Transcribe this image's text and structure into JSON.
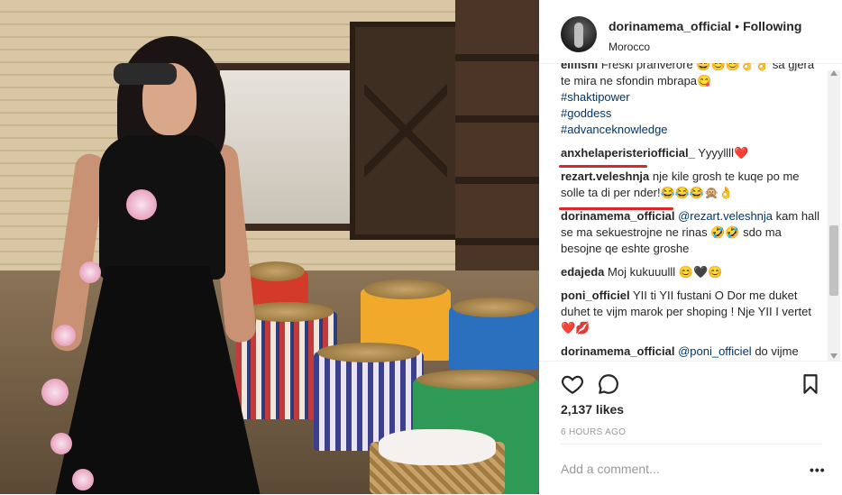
{
  "post": {
    "username": "dorinamema_official",
    "separator": "•",
    "follow_label": "Following",
    "location": "Morocco"
  },
  "comments": [
    {
      "user": "elifishi",
      "text": "Freski pranverore 😄😊😊👌👌",
      "extra": "sa gjera te mira ne sfondin mbrapa😋",
      "tags": [
        "#shaktipower",
        "#goddess",
        "#advanceknowledge"
      ]
    },
    {
      "user": "anxhelaperisteriofficial_",
      "text": "Yyyyllll❤️"
    },
    {
      "user": "rezart.veleshnja",
      "text": "nje kile grosh te kuqe po me solle ta di per nder!😂😂😂🙊👌"
    },
    {
      "user": "dorinamema_official",
      "mention": "@rezart.veleshnja",
      "text": "kam hall se ma sekuestrojne ne rinas 🤣🤣 sdo ma besojne qe eshte groshe"
    },
    {
      "user": "edajeda",
      "text": "Moj kukuuulll 😊🖤😊"
    },
    {
      "user": "poni_officiel",
      "text": "YII ti YII fustani O Dor me duket duhet te vijm marok per shoping ! Nje YII I vertet❤️💋"
    },
    {
      "user": "dorinamema_official",
      "mention": "@poni_officiel",
      "text": "do vijme bashke se skam kohe ta shetis tani... eshte vend fantastik"
    }
  ],
  "likes": "2,137 likes",
  "time": "6 HOURS AGO",
  "add_comment_placeholder": "Add a comment...",
  "more_label": "•••",
  "colors": {
    "underline": "#e0252a",
    "link": "#003569",
    "text": "#262626",
    "muted": "#999999"
  },
  "icons": [
    "heart-icon",
    "comment-icon",
    "bookmark-icon",
    "more-options-icon"
  ]
}
